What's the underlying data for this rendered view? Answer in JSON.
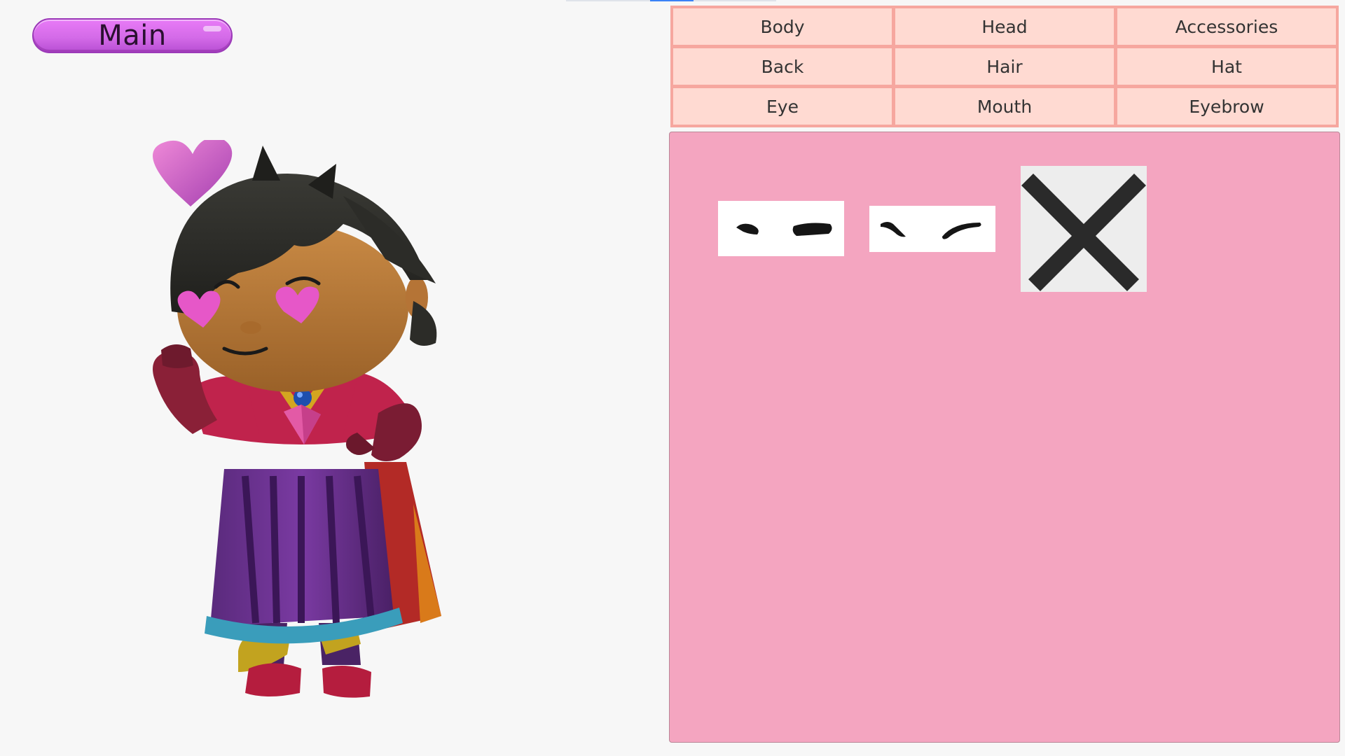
{
  "main_button": {
    "label": "Main"
  },
  "categories": [
    {
      "label": "Body"
    },
    {
      "label": "Head"
    },
    {
      "label": "Accessories"
    },
    {
      "label": "Back"
    },
    {
      "label": "Hair"
    },
    {
      "label": "Hat"
    },
    {
      "label": "Eye"
    },
    {
      "label": "Mouth"
    },
    {
      "label": "Eyebrow"
    }
  ],
  "items": [
    {
      "icon": "eyebrow-style-1-icon"
    },
    {
      "icon": "eyebrow-style-2-icon"
    },
    {
      "icon": "none-x-icon"
    }
  ],
  "colors": {
    "main_button": "#d46be8",
    "tab_bg": "#ffdad2",
    "tab_border": "#f6a79f",
    "panel_bg": "#f4a5c0"
  }
}
